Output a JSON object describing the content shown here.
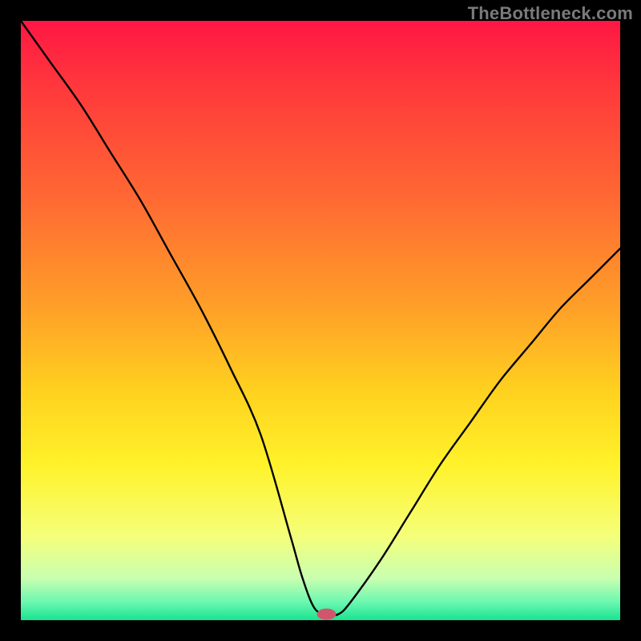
{
  "watermark": "TheBottleneck.com",
  "chart_data": {
    "type": "line",
    "title": "",
    "xlabel": "",
    "ylabel": "",
    "xlim": [
      0,
      100
    ],
    "ylim": [
      0,
      100
    ],
    "x": [
      0,
      5,
      10,
      15,
      20,
      25,
      30,
      35,
      40,
      45,
      47,
      49,
      51,
      53,
      55,
      60,
      65,
      70,
      75,
      80,
      85,
      90,
      95,
      100
    ],
    "values": [
      100,
      93,
      86,
      78,
      70,
      61,
      52,
      42,
      31,
      14,
      7,
      2,
      1,
      1,
      3,
      10,
      18,
      26,
      33,
      40,
      46,
      52,
      57,
      62
    ],
    "gradient_stops": [
      {
        "offset": 0.0,
        "color": "#ff1744"
      },
      {
        "offset": 0.12,
        "color": "#ff3b3b"
      },
      {
        "offset": 0.3,
        "color": "#ff6a33"
      },
      {
        "offset": 0.48,
        "color": "#ffa028"
      },
      {
        "offset": 0.62,
        "color": "#ffd21f"
      },
      {
        "offset": 0.74,
        "color": "#fff22a"
      },
      {
        "offset": 0.86,
        "color": "#f5ff7a"
      },
      {
        "offset": 0.93,
        "color": "#c9ffb0"
      },
      {
        "offset": 0.97,
        "color": "#6cf7b0"
      },
      {
        "offset": 1.0,
        "color": "#18e38f"
      }
    ],
    "marker": {
      "x": 51,
      "y": 1,
      "color": "#d0576b",
      "rx": 12,
      "ry": 7
    }
  }
}
